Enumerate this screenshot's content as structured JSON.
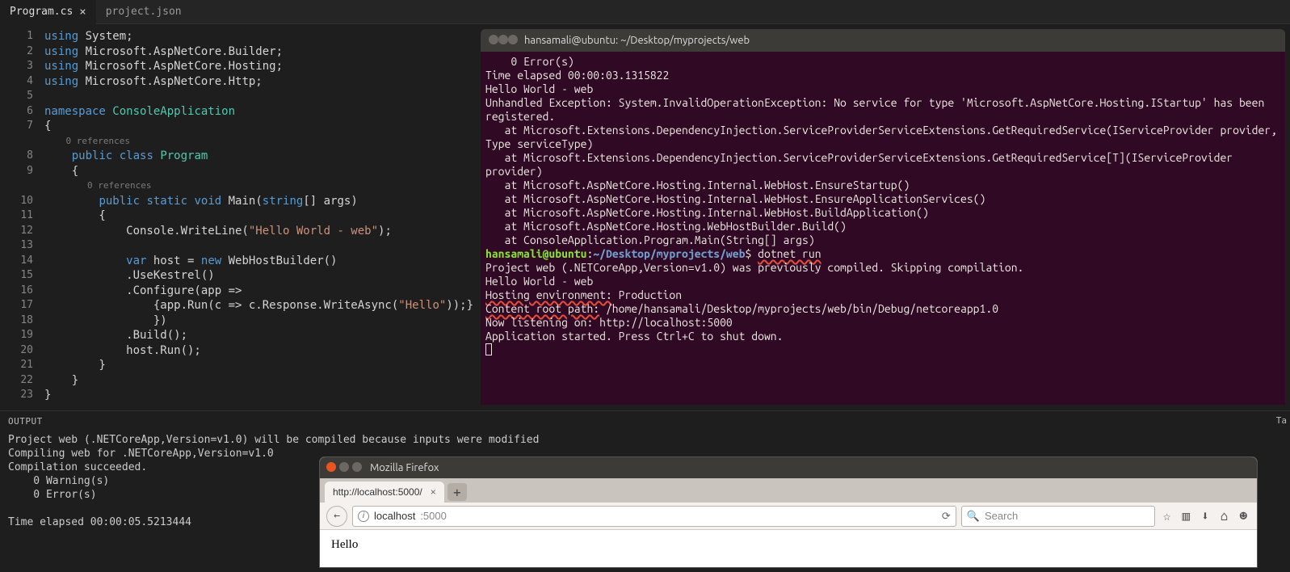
{
  "tabs": [
    {
      "label": "Program.cs",
      "active": true
    },
    {
      "label": "project.json",
      "active": false
    }
  ],
  "editor": {
    "refs": "0 references",
    "lines": [
      {
        "n": 1,
        "seg": [
          [
            "kw",
            "using"
          ],
          [
            "pln",
            " System;"
          ]
        ]
      },
      {
        "n": 2,
        "seg": [
          [
            "kw",
            "using"
          ],
          [
            "pln",
            " Microsoft.AspNetCore.Builder;"
          ]
        ]
      },
      {
        "n": 3,
        "seg": [
          [
            "kw",
            "using"
          ],
          [
            "pln",
            " Microsoft.AspNetCore.Hosting;"
          ]
        ]
      },
      {
        "n": 4,
        "seg": [
          [
            "kw",
            "using"
          ],
          [
            "pln",
            " Microsoft.AspNetCore.Http;"
          ]
        ]
      },
      {
        "n": 5,
        "seg": []
      },
      {
        "n": 6,
        "seg": [
          [
            "kw",
            "namespace"
          ],
          [
            "pln",
            " "
          ],
          [
            "type",
            "ConsoleApplication"
          ]
        ]
      },
      {
        "n": 7,
        "seg": [
          [
            "pln",
            "{"
          ]
        ]
      },
      {
        "ref": true,
        "indent": 4
      },
      {
        "n": 8,
        "seg": [
          [
            "pln",
            "    "
          ],
          [
            "kw",
            "public"
          ],
          [
            "pln",
            " "
          ],
          [
            "kw",
            "class"
          ],
          [
            "pln",
            " "
          ],
          [
            "type",
            "Program"
          ]
        ]
      },
      {
        "n": 9,
        "seg": [
          [
            "pln",
            "    {"
          ]
        ]
      },
      {
        "ref": true,
        "indent": 8
      },
      {
        "n": 10,
        "seg": [
          [
            "pln",
            "        "
          ],
          [
            "kw",
            "public"
          ],
          [
            "pln",
            " "
          ],
          [
            "kw",
            "static"
          ],
          [
            "pln",
            " "
          ],
          [
            "kw",
            "void"
          ],
          [
            "pln",
            " Main("
          ],
          [
            "kw",
            "string"
          ],
          [
            "pln",
            "[] args)"
          ]
        ]
      },
      {
        "n": 11,
        "seg": [
          [
            "pln",
            "        {"
          ]
        ]
      },
      {
        "n": 12,
        "seg": [
          [
            "pln",
            "            Console.WriteLine("
          ],
          [
            "str",
            "\"Hello World - web\""
          ],
          [
            "pln",
            ");"
          ]
        ]
      },
      {
        "n": 13,
        "seg": []
      },
      {
        "n": 14,
        "seg": [
          [
            "pln",
            "            "
          ],
          [
            "kw",
            "var"
          ],
          [
            "pln",
            " host = "
          ],
          [
            "kw",
            "new"
          ],
          [
            "pln",
            " WebHostBuilder()"
          ]
        ]
      },
      {
        "n": 15,
        "seg": [
          [
            "pln",
            "            .UseKestrel()"
          ]
        ]
      },
      {
        "n": 16,
        "seg": [
          [
            "pln",
            "            .Configure(app =>"
          ]
        ]
      },
      {
        "n": 17,
        "seg": [
          [
            "pln",
            "                {app.Run(c => c.Response.WriteAsync("
          ],
          [
            "str",
            "\"Hello\""
          ],
          [
            "pln",
            "));}"
          ]
        ]
      },
      {
        "n": 18,
        "seg": [
          [
            "pln",
            "                })"
          ]
        ]
      },
      {
        "n": 19,
        "seg": [
          [
            "pln",
            "            .Build();"
          ]
        ]
      },
      {
        "n": 20,
        "seg": [
          [
            "pln",
            "            host.Run();"
          ]
        ]
      },
      {
        "n": 21,
        "seg": [
          [
            "pln",
            "        }"
          ]
        ]
      },
      {
        "n": 22,
        "seg": [
          [
            "pln",
            "    }"
          ]
        ]
      },
      {
        "n": 23,
        "seg": [
          [
            "pln",
            "}"
          ]
        ]
      }
    ]
  },
  "terminal": {
    "title": "hansamali@ubuntu: ~/Desktop/myprojects/web",
    "btns": [
      "#6b6762",
      "#6b6762",
      "#6b6762"
    ],
    "lines": [
      [
        [
          "twhite",
          "    0 Error(s)"
        ]
      ],
      [
        [
          "twhite",
          ""
        ]
      ],
      [
        [
          "twhite",
          "Time elapsed 00:00:03.1315822"
        ]
      ],
      [
        [
          "twhite",
          ""
        ]
      ],
      [
        [
          "twhite",
          ""
        ]
      ],
      [
        [
          "twhite",
          "Hello World - web"
        ]
      ],
      [
        [
          "twhite",
          ""
        ]
      ],
      [
        [
          "twhite",
          "Unhandled Exception: System.InvalidOperationException: No service for type 'Microsoft.AspNetCore.Hosting.IStartup' has been registered."
        ]
      ],
      [
        [
          "twhite",
          "   at Microsoft.Extensions.DependencyInjection.ServiceProviderServiceExtensions.GetRequiredService(IServiceProvider provider, Type serviceType)"
        ]
      ],
      [
        [
          "twhite",
          "   at Microsoft.Extensions.DependencyInjection.ServiceProviderServiceExtensions.GetRequiredService[T](IServiceProvider provider)"
        ]
      ],
      [
        [
          "twhite",
          "   at Microsoft.AspNetCore.Hosting.Internal.WebHost.EnsureStartup()"
        ]
      ],
      [
        [
          "twhite",
          "   at Microsoft.AspNetCore.Hosting.Internal.WebHost.EnsureApplicationServices()"
        ]
      ],
      [
        [
          "twhite",
          "   at Microsoft.AspNetCore.Hosting.Internal.WebHost.BuildApplication()"
        ]
      ],
      [
        [
          "twhite",
          "   at Microsoft.AspNetCore.Hosting.WebHostBuilder.Build()"
        ]
      ],
      [
        [
          "twhite",
          "   at ConsoleApplication.Program.Main(String[] args)"
        ]
      ],
      [
        [
          "tgreen",
          "hansamali@ubuntu"
        ],
        [
          "twhite",
          ":"
        ],
        [
          "tblue",
          "~/Desktop/myprojects/web"
        ],
        [
          "twhite",
          "$ "
        ],
        [
          "twhite underline-red",
          "dotnet run"
        ]
      ],
      [
        [
          "twhite",
          "Project web (.NETCoreApp,Version=v1.0) was previously compiled. Skipping compilation."
        ]
      ],
      [
        [
          "twhite",
          "Hello World - web"
        ]
      ],
      [
        [
          "twhite underline-red",
          "Hosting environment:"
        ],
        [
          "twhite",
          " Production"
        ]
      ],
      [
        [
          "twhite underline-red",
          "Content root path:"
        ],
        [
          "twhite",
          " /home/hansamali/Desktop/myprojects/web/bin/Debug/netcoreapp1.0"
        ]
      ],
      [
        [
          "twhite",
          "Now listening on: http://localhost:5000"
        ]
      ],
      [
        [
          "twhite",
          "Application started. Press Ctrl+C to shut down."
        ]
      ]
    ]
  },
  "output": {
    "title": "OUTPUT",
    "right_edge": "Ta",
    "text": "Project web (.NETCoreApp,Version=v1.0) will be compiled because inputs were modified\nCompiling web for .NETCoreApp,Version=v1.0\nCompilation succeeded.\n    0 Warning(s)\n    0 Error(s)\n\nTime elapsed 00:00:05.5213444"
  },
  "firefox": {
    "title": "Mozilla Firefox",
    "btns": [
      "#e95420",
      "#6b6762",
      "#6b6762"
    ],
    "tab_label": "http://localhost:5000/",
    "url_host": "localhost",
    "url_path": ":5000",
    "search_placeholder": "Search",
    "page_body": "Hello",
    "icons": {
      "star": "☆",
      "books": "▥",
      "download": "⬇",
      "home": "⌂",
      "smile": "☻",
      "plus": "+",
      "back": "←",
      "refresh": "⟳",
      "search": "🔍"
    }
  }
}
